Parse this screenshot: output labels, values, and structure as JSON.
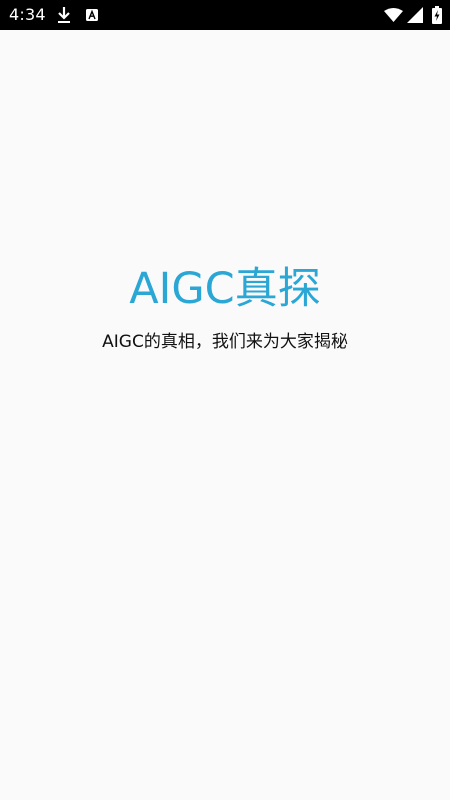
{
  "status_bar": {
    "time": "4:34",
    "icons": [
      "download-icon",
      "a-badge-icon",
      "wifi-icon",
      "cell-signal-icon",
      "battery-charging-icon"
    ],
    "background": "#000000",
    "foreground": "#ffffff"
  },
  "splash": {
    "title": "AIGC真探",
    "subtitle": "AIGC的真相，我们来为大家揭秘",
    "title_color": "#2aa7d5",
    "background": "#fafafa"
  }
}
